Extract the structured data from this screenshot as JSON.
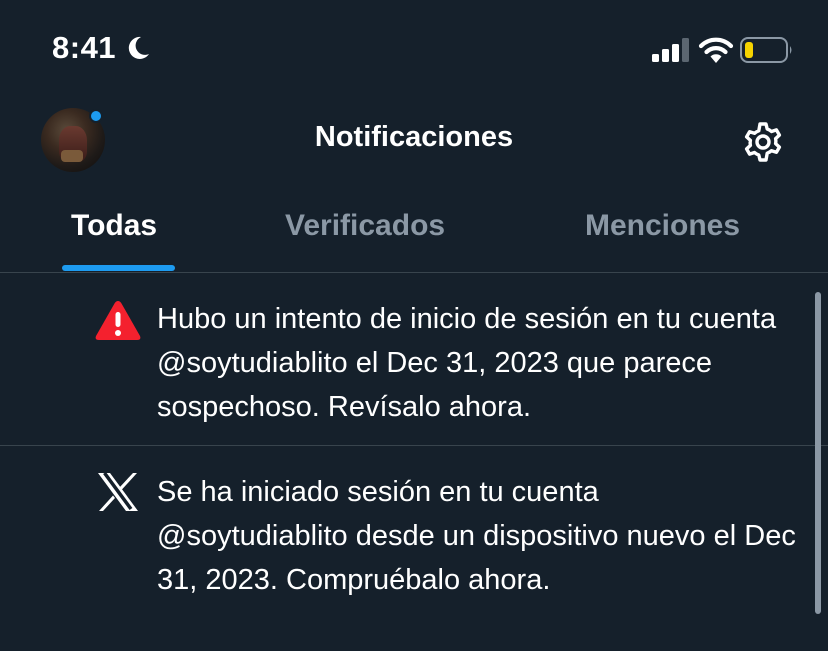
{
  "status_bar": {
    "time": "8:41",
    "focus_icon": "moon-icon",
    "signal_icon": "cellular-signal-icon",
    "wifi_icon": "wifi-icon",
    "battery_icon": "battery-low-icon",
    "battery_color": "#f5d300"
  },
  "header": {
    "title": "Notificaciones",
    "avatar_dot_color": "#1d9bf0",
    "settings_icon": "gear-icon"
  },
  "tabs": [
    {
      "label": "Todas",
      "active": true
    },
    {
      "label": "Verificados",
      "active": false
    },
    {
      "label": "Menciones",
      "active": false
    }
  ],
  "notifications": [
    {
      "icon": "warning-triangle-icon",
      "icon_color": "#f4212e",
      "text": "Hubo un intento de inicio de sesión en tu cuenta @soytudiablito el Dec 31, 2023 que parece sospechoso. Revísalo ahora."
    },
    {
      "icon": "x-logo-icon",
      "icon_color": "#ffffff",
      "text": "Se ha iniciado sesión en tu cuenta @soytudiablito desde un dispositivo nuevo el Dec 31, 2023. Compruébalo ahora."
    }
  ],
  "colors": {
    "background": "#15202b",
    "accent": "#1d9bf0",
    "muted_text": "#8b98a5",
    "divider": "#38444d"
  }
}
